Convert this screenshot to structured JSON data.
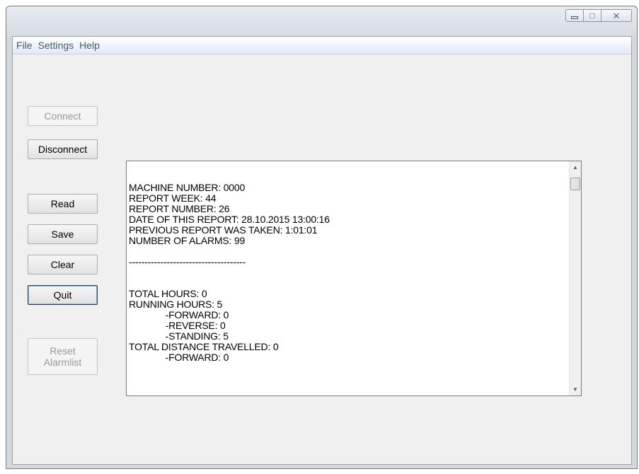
{
  "window": {
    "caption_buttons": {
      "minimize_icon": "minimize-icon",
      "maximize_icon": "maximize-icon",
      "close_icon": "close-icon",
      "close_glyph": "✕"
    }
  },
  "menubar": {
    "items": [
      "File",
      "Settings",
      "Help"
    ]
  },
  "buttons": {
    "connect": "Connect",
    "disconnect": "Disconnect",
    "read": "Read",
    "save": "Save",
    "clear": "Clear",
    "quit": "Quit",
    "reset_alarmlist": "Reset\nAlarmlist"
  },
  "report": {
    "text": "\n\nMACHINE NUMBER: 0000\nREPORT WEEK: 44\nREPORT NUMBER: 26\nDATE OF THIS REPORT: 28.10.2015 13:00:16\nPREVIOUS REPORT WAS TAKEN: 1:01:01\nNUMBER OF ALARMS: 99\n\n-------------------------------------\n\n\nTOTAL HOURS: 0\nRUNNING HOURS: 5\n              -FORWARD: 0\n              -REVERSE: 0\n              -STANDING: 5\nTOTAL DISTANCE TRAVELLED: 0\n              -FORWARD: 0"
  },
  "scrollbar": {
    "up_arrow": "▲",
    "down_arrow": "▼"
  }
}
